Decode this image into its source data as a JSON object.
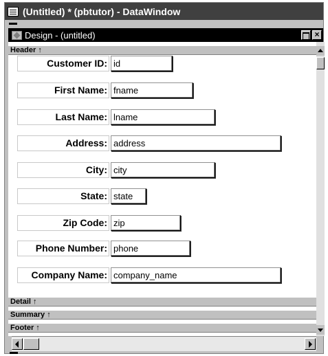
{
  "window": {
    "title": "(Untitled) * (pbtutor) - DataWindow",
    "icon": "datawindow-icon"
  },
  "design_window": {
    "title": "Design - (untitled)",
    "icon": "design-painter-icon",
    "restore_label": "",
    "close_label": "×"
  },
  "bands": {
    "header": "Header ↑",
    "detail": "Detail ↑",
    "summary": "Summary ↑",
    "footer": "Footer ↑"
  },
  "fields": [
    {
      "label": "Customer ID:",
      "column": "id"
    },
    {
      "label": "First Name:",
      "column": "fname"
    },
    {
      "label": "Last Name:",
      "column": "lname"
    },
    {
      "label": "Address:",
      "column": "address"
    },
    {
      "label": "City:",
      "column": "city"
    },
    {
      "label": "State:",
      "column": "state"
    },
    {
      "label": "Zip Code:",
      "column": "zip"
    },
    {
      "label": "Phone Number:",
      "column": "phone"
    },
    {
      "label": "Company Name:",
      "column": "company_name"
    }
  ],
  "colors": {
    "title_bar": "#404040",
    "inner_title_bar": "#000000",
    "chrome": "#c0c0c0",
    "surface": "#ffffff"
  }
}
